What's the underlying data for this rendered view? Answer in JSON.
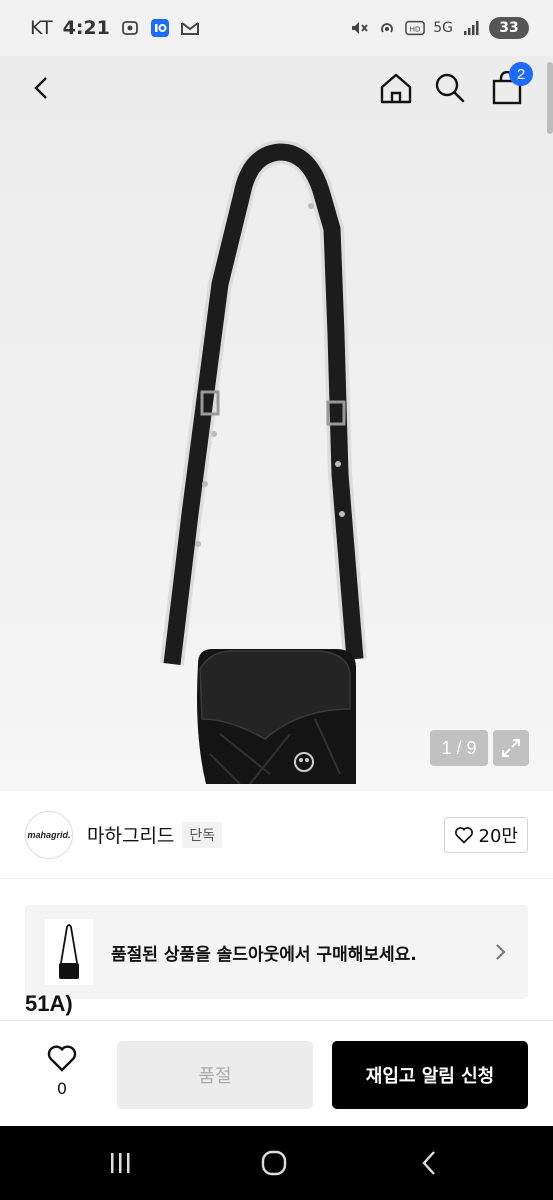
{
  "status_bar": {
    "carrier": "KT",
    "time": "4:21",
    "network": "5G",
    "battery": "33"
  },
  "gallery": {
    "pager": "1 / 9",
    "cart_count": "2"
  },
  "brand": {
    "logo_text": "mahagrid.",
    "name": "마하그리드",
    "tag": "단독",
    "likes": "20만"
  },
  "soldout_banner": {
    "text": "품절된 상품을 솔드아웃에서 구매해보세요."
  },
  "cut_off_text": "51A)",
  "bottom_bar": {
    "wish_count": "0",
    "soldout_label": "품절",
    "restock_label": "재입고 알림 신청"
  },
  "colors": {
    "accent_badge": "#1e6bff",
    "primary_button": "#000000"
  }
}
